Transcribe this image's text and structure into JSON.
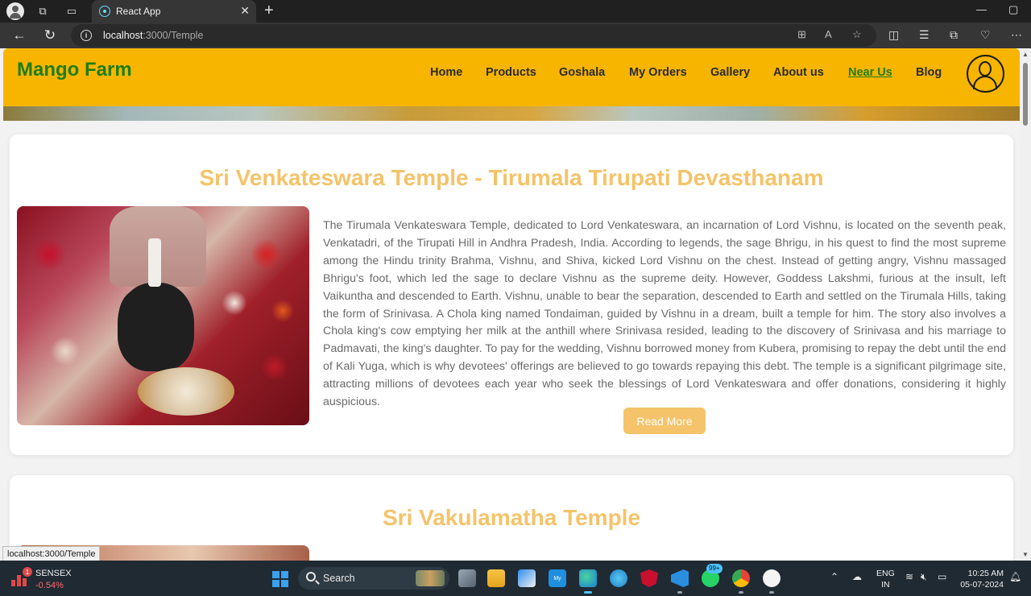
{
  "browser": {
    "tab_title": "React App",
    "url_host": "localhost",
    "url_path": ":3000/Temple",
    "status_url": "localhost:3000/Temple"
  },
  "site": {
    "brand": "Mango Farm",
    "nav": [
      "Home",
      "Products",
      "Goshala",
      "My Orders",
      "Gallery",
      "About us",
      "Near Us",
      "Blog"
    ],
    "active_nav": "Near Us",
    "brand_color": "#1e7d18",
    "header_color": "#f7b500",
    "accent_color": "#f4c36a"
  },
  "temples": [
    {
      "title": "Sri Venkateswara Temple - Tirumala Tirupati Devasthanam",
      "description": "The Tirumala Venkateswara Temple, dedicated to Lord Venkateswara, an incarnation of Lord Vishnu, is located on the seventh peak, Venkatadri, of the Tirupati Hill in Andhra Pradesh, India. According to legends, the sage Bhrigu, in his quest to find the most supreme among the Hindu trinity Brahma, Vishnu, and Shiva, kicked Lord Vishnu on the chest. Instead of getting angry, Vishnu massaged Bhrigu's foot, which led the sage to declare Vishnu as the supreme deity. However, Goddess Lakshmi, furious at the insult, left Vaikuntha and descended to Earth. Vishnu, unable to bear the separation, descended to Earth and settled on the Tirumala Hills, taking the form of Srinivasa. A Chola king named Tondaiman, guided by Vishnu in a dream, built a temple for him. The story also involves a Chola king's cow emptying her milk at the anthill where Srinivasa resided, leading to the discovery of Srinivasa and his marriage to Padmavati, the king's daughter. To pay for the wedding, Vishnu borrowed money from Kubera, promising to repay the debt until the end of Kali Yuga, which is why devotees' offerings are believed to go towards repaying this debt. The temple is a significant pilgrimage site, attracting millions of devotees each year who seek the blessings of Lord Venkateswara and offer donations, considering it highly auspicious.",
      "button": "Read More"
    },
    {
      "title": "Sri Vakulamatha Temple"
    }
  ],
  "taskbar": {
    "ticker_name": "SENSEX",
    "ticker_value": "-0.54%",
    "ticker_badge": "1",
    "search_label": "Search",
    "whatsapp_badge": "99+",
    "lang_line1": "ENG",
    "lang_line2": "IN",
    "time": "10:25 AM",
    "date": "05-07-2024"
  }
}
